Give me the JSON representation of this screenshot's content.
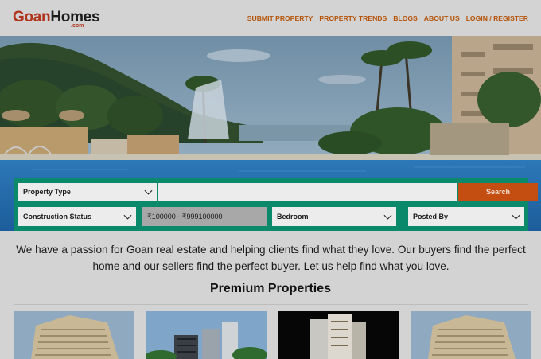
{
  "header": {
    "logo_main_part1": "Goan",
    "logo_main_part2": "Homes",
    "logo_sub": ".com",
    "nav": [
      {
        "label": "SUBMIT PROPERTY"
      },
      {
        "label": "PROPERTY TRENDS"
      },
      {
        "label": "BLOGS"
      },
      {
        "label": "ABOUT US"
      },
      {
        "label": "LOGIN / REGISTER"
      }
    ]
  },
  "search": {
    "property_type": "Property Type",
    "search_value": "",
    "search_button": "Search",
    "construction_status": "Construction Status",
    "price_range": "₹100000 - ₹999100000",
    "bedroom": "Bedroom",
    "posted_by": "Posted By"
  },
  "intro": {
    "text": "We have a passion for Goan real estate and helping clients find what they love. Our buyers find the perfect home and our sellers find the perfect buyer. Let us help find what you love."
  },
  "premium": {
    "title": "Premium Properties"
  },
  "colors": {
    "brand": "#b0341c",
    "nav": "#b55206",
    "panel": "#0a8a6a",
    "search_button": "#c44d12"
  }
}
